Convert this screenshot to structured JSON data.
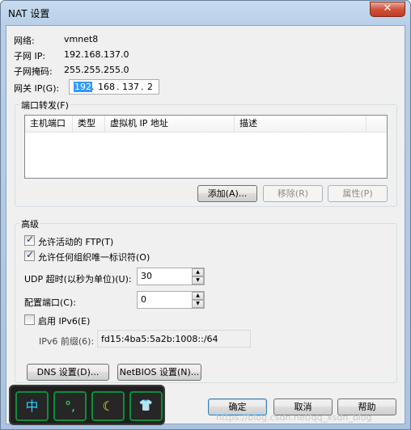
{
  "window": {
    "title": "NAT 设置",
    "close_label": "✕"
  },
  "network": {
    "network_label": "网络:",
    "network_value": "vmnet8",
    "subnet_ip_label": "子网 IP:",
    "subnet_ip_value": "192.168.137.0",
    "mask_label": "子网掩码:",
    "mask_value": "255.255.255.0",
    "gateway_label": "网关 IP(G):",
    "gateway_octets": [
      "192",
      "168",
      "137",
      "2"
    ]
  },
  "port_forwarding": {
    "group_title": "端口转发(F)",
    "columns": [
      "主机端口",
      "类型",
      "虚拟机 IP 地址",
      "描述"
    ],
    "add_button": "添加(A)...",
    "remove_button": "移除(R)",
    "properties_button": "属性(P)"
  },
  "advanced": {
    "group_title": "高级",
    "allow_ftp": {
      "label": "允许活动的 FTP(T)",
      "checked": true
    },
    "allow_oui": {
      "label": "允许任何组织唯一标识符(O)",
      "checked": true
    },
    "udp_timeout_label": "UDP 超时(以秒为单位)(U):",
    "udp_timeout_value": "30",
    "config_port_label": "配置端口(C):",
    "config_port_value": "0",
    "enable_ipv6": {
      "label": "启用 IPv6(E)",
      "checked": false
    },
    "ipv6_prefix_label": "IPv6 前缀(6):",
    "ipv6_prefix_value": "fd15:4ba5:5a2b:1008::/64",
    "dns_button": "DNS 设置(D)...",
    "netbios_button": "NetBIOS 设置(N)..."
  },
  "footer": {
    "ok_button": "确定",
    "cancel_button": "取消",
    "help_button": "帮助"
  },
  "ime_toolbar": {
    "keys": [
      "中",
      "°,",
      "☾",
      "👕"
    ]
  },
  "watermark": "https://blog.csdn.net/qq_xsdn_blog"
}
